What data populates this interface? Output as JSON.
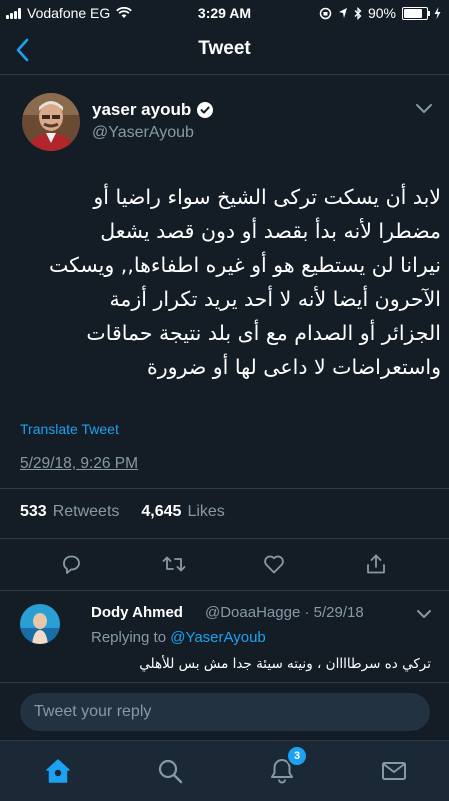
{
  "status_bar": {
    "carrier": "Vodafone EG",
    "time": "3:29 AM",
    "battery": "90%",
    "battery_level": 0.9
  },
  "header": {
    "title": "Tweet"
  },
  "tweet": {
    "author_name": "yaser ayoub",
    "author_handle": "@YaserAyoub",
    "text_lines": [
      "لابد أن يسكت تركى الشيخ سواء راضيا أو",
      "مضطرا لأنه بدأ بقصد أو دون قصد يشعل",
      "نيرانا لن يستطيع هو أو غيره اطفاءها,, ويسكت",
      "الآحرون أيضا لأنه لا أحد يريد تكرار أزمة",
      "الجزائر أو الصدام مع أى بلد نتيجة حماقات",
      "واستعراضات لا داعى لها أو ضرورة"
    ],
    "translate_label": "Translate Tweet",
    "date": "5/29/18, 9:26 PM",
    "retweets_count": "533",
    "retweets_label": "Retweets",
    "likes_count": "4,645",
    "likes_label": "Likes"
  },
  "reply": {
    "author_name": "Dody Ahmed",
    "author_handle_date": "@DoaaHagge · 5/29/18",
    "replying_to_label": "Replying to",
    "replying_to_handle": "@YaserAyoub",
    "text": "تركي ده سرطاااان ، ونيته سيئة جدا مش بس للأهلي"
  },
  "reply_box": {
    "placeholder": "Tweet your reply"
  },
  "tab_bar": {
    "notifications_badge": "3"
  },
  "colors": {
    "background": "#141d26",
    "accent": "#1da1f2",
    "muted": "#8899a6",
    "divider": "#2f3c4a"
  }
}
